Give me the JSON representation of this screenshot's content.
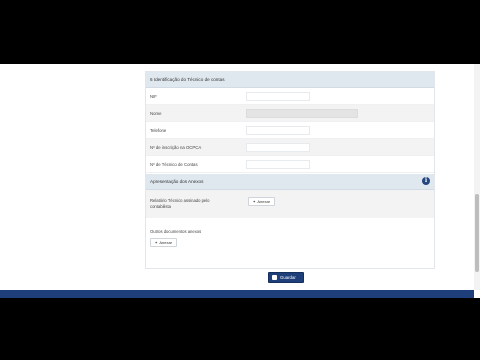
{
  "section1": {
    "title": "6 Identificação do Técnico de contas",
    "fields": [
      {
        "label": "NIF",
        "value": ""
      },
      {
        "label": "Nome",
        "value": ""
      },
      {
        "label": "Telefone",
        "value": ""
      },
      {
        "label": "Nº de inscrição na OCPCA",
        "value": ""
      },
      {
        "label": "Nº de Técnico de Contas",
        "value": ""
      }
    ]
  },
  "section2": {
    "title": "Apresentação dos Anexos",
    "info_icon": "info-icon",
    "report_label": "Relatório Técnico assinado pelo contabilista",
    "attach_label": "Anexar",
    "other_docs_label": "Outros documentos anexos",
    "other_attach_label": "Anexar"
  },
  "actions": {
    "save_label": "Guardar"
  },
  "colors": {
    "primary": "#1f3f7a",
    "header_bg": "#dfe8ef",
    "row_alt": "#f3f3f3"
  }
}
